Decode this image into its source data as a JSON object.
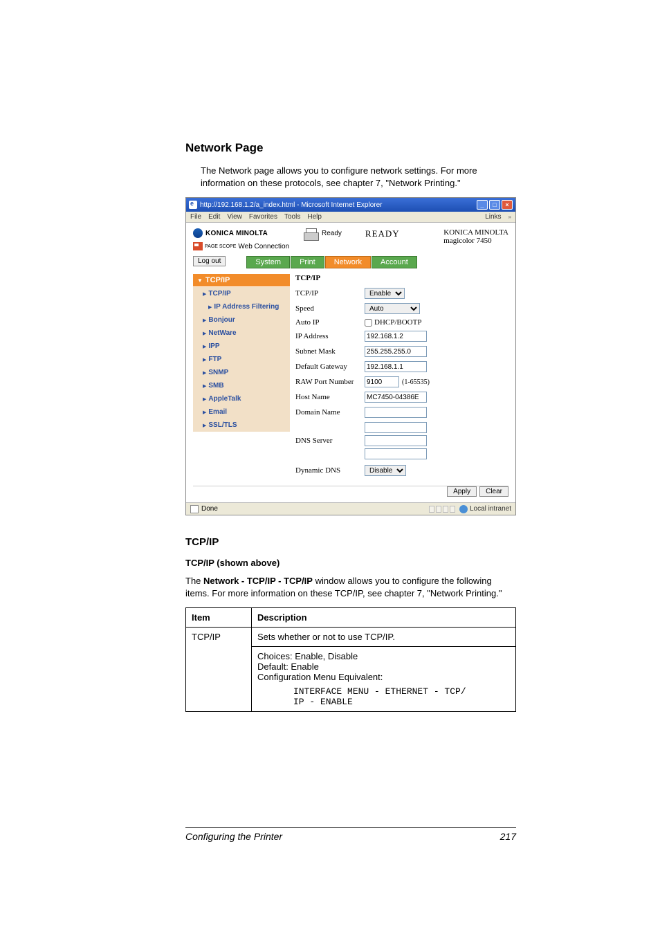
{
  "heading": "Network Page",
  "intro": "The Network page allows you to configure network settings. For more information on these protocols, see chapter 7, \"Network Printing.\"",
  "browser": {
    "title": "http://192.168.1.2/a_index.html - Microsoft Internet Explorer",
    "menus": [
      "File",
      "Edit",
      "View",
      "Favorites",
      "Tools",
      "Help"
    ],
    "links_label": "Links",
    "header": {
      "brand": "KONICA MINOLTA",
      "pagescope_prefix": "PAGE SCOPE",
      "pagescope": "Web Connection",
      "ready_small": "Ready",
      "ready_big": "READY",
      "model_line1": "KONICA MINOLTA",
      "model_line2": "magicolor 7450"
    },
    "logout": "Log out",
    "tabs": [
      "System",
      "Print",
      "Network",
      "Account"
    ],
    "active_tab_index": 2,
    "sidebar": {
      "section": "TCP/IP",
      "items": [
        {
          "label": "TCP/IP",
          "bold": true,
          "sub": false
        },
        {
          "label": "IP Address Filtering",
          "bold": true,
          "sub": true
        },
        {
          "label": "Bonjour",
          "bold": true,
          "sub": false
        },
        {
          "label": "NetWare",
          "bold": true,
          "sub": false
        },
        {
          "label": "IPP",
          "bold": true,
          "sub": false
        },
        {
          "label": "FTP",
          "bold": true,
          "sub": false
        },
        {
          "label": "SNMP",
          "bold": true,
          "sub": false
        },
        {
          "label": "SMB",
          "bold": true,
          "sub": false
        },
        {
          "label": "AppleTalk",
          "bold": true,
          "sub": false
        },
        {
          "label": "Email",
          "bold": true,
          "sub": false
        },
        {
          "label": "SSL/TLS",
          "bold": true,
          "sub": false
        }
      ]
    },
    "form": {
      "title": "TCP/IP",
      "rows": {
        "tcpip": {
          "label": "TCP/IP",
          "value": "Enable"
        },
        "speed": {
          "label": "Speed",
          "value": "Auto"
        },
        "autoip": {
          "label": "Auto IP",
          "value": "DHCP/BOOTP"
        },
        "ipaddr": {
          "label": "IP Address",
          "value": "192.168.1.2"
        },
        "subnet": {
          "label": "Subnet Mask",
          "value": "255.255.255.0"
        },
        "gateway": {
          "label": "Default Gateway",
          "value": "192.168.1.1"
        },
        "rawport": {
          "label": "RAW Port Number",
          "value": "9100",
          "suffix": "(1-65535)"
        },
        "hostname": {
          "label": "Host Name",
          "value": "MC7450-04386E"
        },
        "domain": {
          "label": "Domain Name",
          "value": ""
        },
        "dns": {
          "label": "DNS Server",
          "value": ""
        },
        "dyndns": {
          "label": "Dynamic DNS",
          "value": "Disable"
        }
      },
      "apply": "Apply",
      "clear": "Clear"
    },
    "status": {
      "done": "Done",
      "zone": "Local intranet"
    }
  },
  "section": {
    "h2": "TCP/IP",
    "h3": "TCP/IP (shown above)",
    "para_pre": "The ",
    "para_bold": "Network - TCP/IP - TCP/IP",
    "para_post": " window allows you to configure the following items. For more information on these TCP/IP, see chapter 7, \"Network Printing.\"",
    "th_item": "Item",
    "th_desc": "Description",
    "row_item": "TCP/IP",
    "row_desc1": "Sets whether or not to use TCP/IP.",
    "row_choices": "Choices: Enable, Disable",
    "row_default": "Default:  Enable",
    "row_cfg": "Configuration Menu Equivalent:",
    "row_mono1": "INTERFACE MENU - ETHERNET - TCP/",
    "row_mono2": "IP - ENABLE"
  },
  "footer": {
    "left": "Configuring the Printer",
    "right": "217"
  }
}
